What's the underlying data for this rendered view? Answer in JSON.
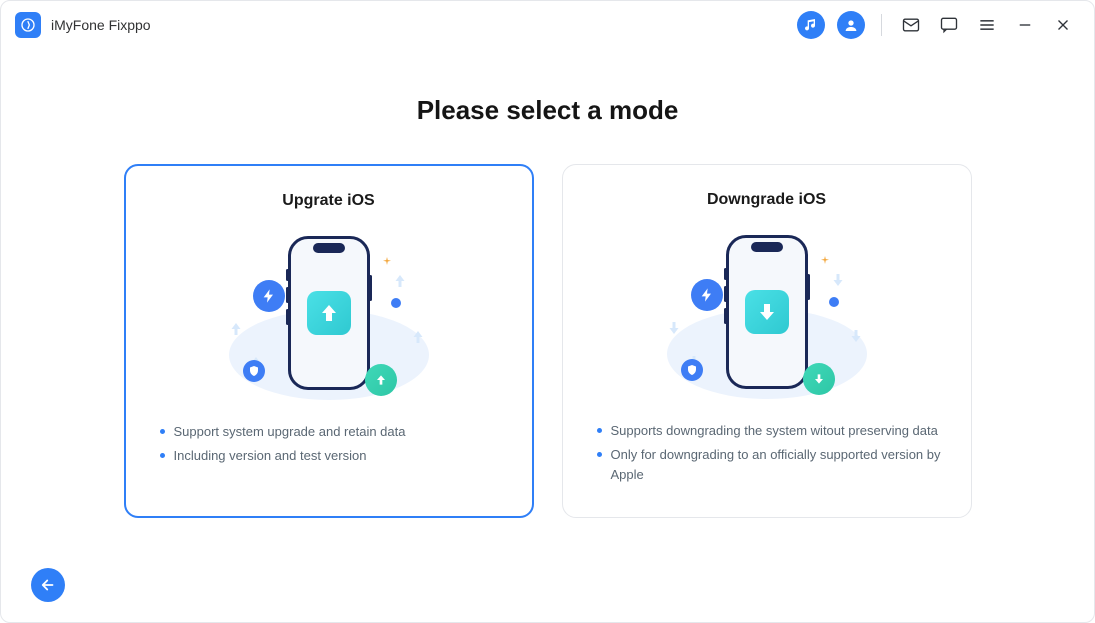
{
  "app": {
    "title": "iMyFone Fixppo"
  },
  "page": {
    "heading": "Please select a mode"
  },
  "modes": {
    "upgrade": {
      "title": "Upgrate iOS",
      "features": [
        "Support system upgrade and retain data",
        "Including version and test version"
      ]
    },
    "downgrade": {
      "title": "Downgrade iOS",
      "features": [
        "Supports downgrading the system witout preserving data",
        "Only for downgrading to an officially supported version by Apple"
      ]
    }
  },
  "colors": {
    "accent": "#2f7ff7",
    "teal": "#3fd8b8"
  }
}
